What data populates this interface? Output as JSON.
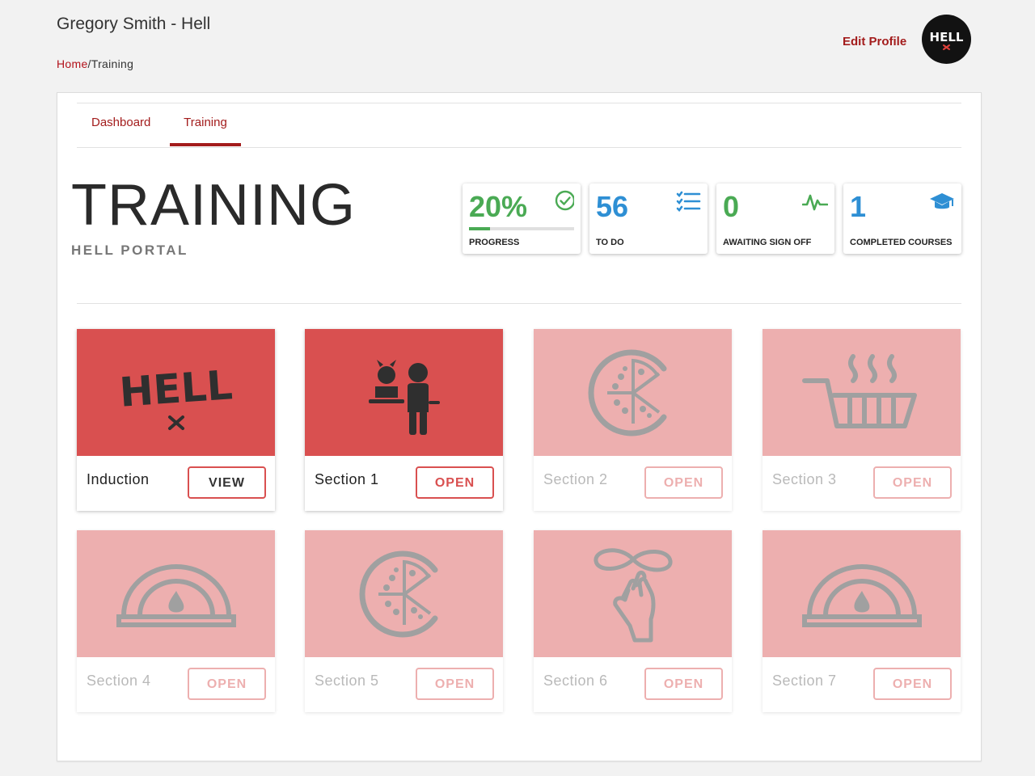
{
  "header": {
    "user_name": "Gregory Smith - Hell",
    "edit_profile": "Edit Profile",
    "avatar_text": "HELL"
  },
  "breadcrumb": {
    "home": "Home",
    "separator": "/",
    "current": "Training"
  },
  "tabs": [
    {
      "label": "Dashboard",
      "active": false
    },
    {
      "label": "Training",
      "active": true
    }
  ],
  "page": {
    "title": "TRAINING",
    "subtitle": "HELL PORTAL"
  },
  "stats": [
    {
      "value": "20%",
      "label": "PROGRESS",
      "icon": "check-circle-icon",
      "color": "#4aaa54",
      "progress": 0.2
    },
    {
      "value": "56",
      "label": "TO DO",
      "icon": "checklist-icon",
      "color": "#2e8fd4"
    },
    {
      "value": "0",
      "label": "AWAITING SIGN OFF",
      "icon": "pulse-icon",
      "color": "#4aaa54"
    },
    {
      "value": "1",
      "label": "COMPLETED COURSES",
      "icon": "graduation-cap-icon",
      "color": "#2e8fd4"
    }
  ],
  "courses": [
    {
      "name": "Induction",
      "button": "VIEW",
      "icon": "hell-logo-icon",
      "locked": false
    },
    {
      "name": "Section 1",
      "button": "OPEN",
      "icon": "waiter-devil-icon",
      "locked": false
    },
    {
      "name": "Section 2",
      "button": "OPEN",
      "icon": "pizza-icon",
      "locked": true
    },
    {
      "name": "Section 3",
      "button": "OPEN",
      "icon": "hot-basket-icon",
      "locked": true
    },
    {
      "name": "Section 4",
      "button": "OPEN",
      "icon": "pizza-oven-icon",
      "locked": true
    },
    {
      "name": "Section 5",
      "button": "OPEN",
      "icon": "pizza-icon",
      "locked": true
    },
    {
      "name": "Section 6",
      "button": "OPEN",
      "icon": "dough-toss-icon",
      "locked": true
    },
    {
      "name": "Section 7",
      "button": "OPEN",
      "icon": "pizza-oven-icon",
      "locked": true
    }
  ],
  "colors": {
    "brand": "#a31c1c",
    "banner": "#d95050",
    "progress": "#4aaa54",
    "info": "#2e8fd4"
  }
}
